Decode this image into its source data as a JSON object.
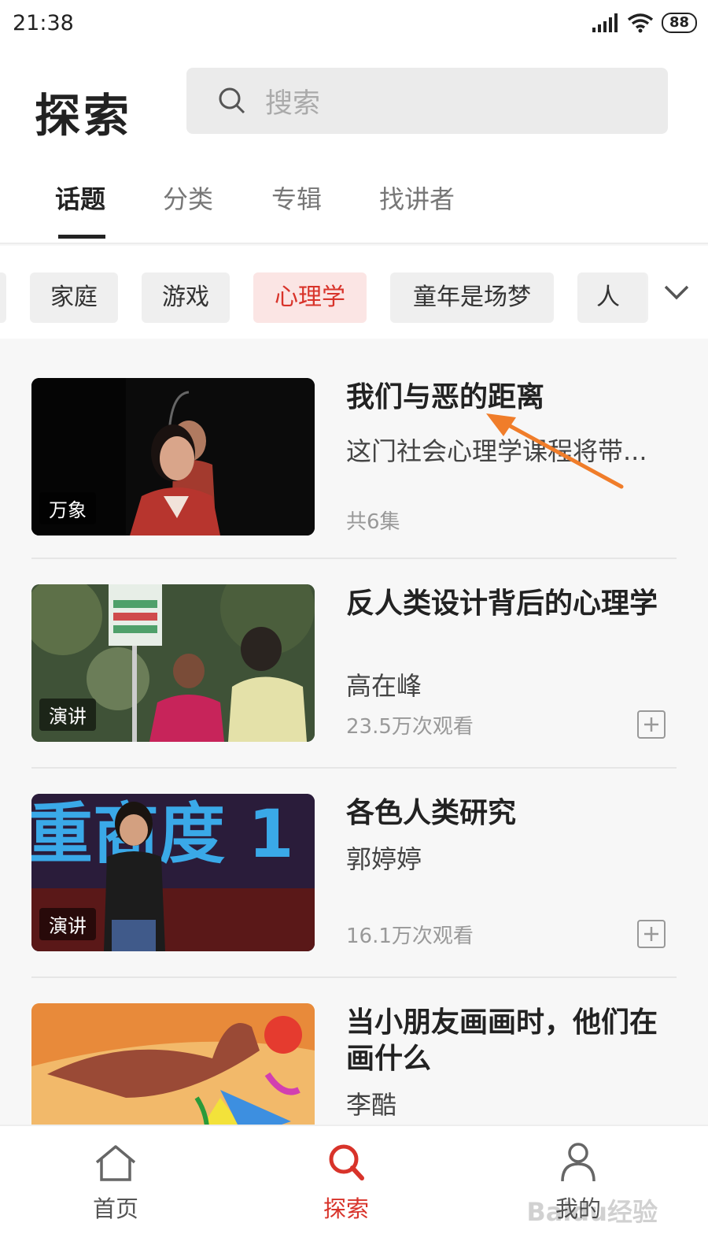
{
  "status": {
    "time": "21:38",
    "battery": "88"
  },
  "header": {
    "title": "探索",
    "search_placeholder": "搜索"
  },
  "tabs": [
    {
      "label": "话题",
      "active": true
    },
    {
      "label": "分类",
      "active": false
    },
    {
      "label": "专辑",
      "active": false
    },
    {
      "label": "找讲者",
      "active": false
    }
  ],
  "chips": [
    {
      "label": "家庭",
      "active": false
    },
    {
      "label": "游戏",
      "active": false
    },
    {
      "label": "心理学",
      "active": true
    },
    {
      "label": "童年是场梦",
      "active": false
    },
    {
      "label": "人",
      "active": false
    }
  ],
  "items": [
    {
      "tag": "万象",
      "title": "我们与恶的距离",
      "subtitle": "这门社会心理学课程将带...",
      "meta": "共6集"
    },
    {
      "tag": "演讲",
      "title": "反人类设计背后的心理学",
      "subtitle": "高在峰",
      "meta": "23.5万次观看"
    },
    {
      "tag": "演讲",
      "title": "各色人类研究",
      "subtitle": "郭婷婷",
      "meta": "16.1万次观看"
    },
    {
      "tag": "",
      "title": "当小朋友画画时，他们在画什么",
      "subtitle": "李酷",
      "meta": ""
    }
  ],
  "bottom_nav": [
    {
      "label": "首页",
      "icon": "home-icon",
      "active": false
    },
    {
      "label": "探索",
      "icon": "search-icon",
      "active": true
    },
    {
      "label": "我的",
      "icon": "person-icon",
      "active": false
    }
  ],
  "watermark": "Baidu经验",
  "colors": {
    "accent": "#d8332a",
    "annotation_arrow": "#f07d2a"
  }
}
